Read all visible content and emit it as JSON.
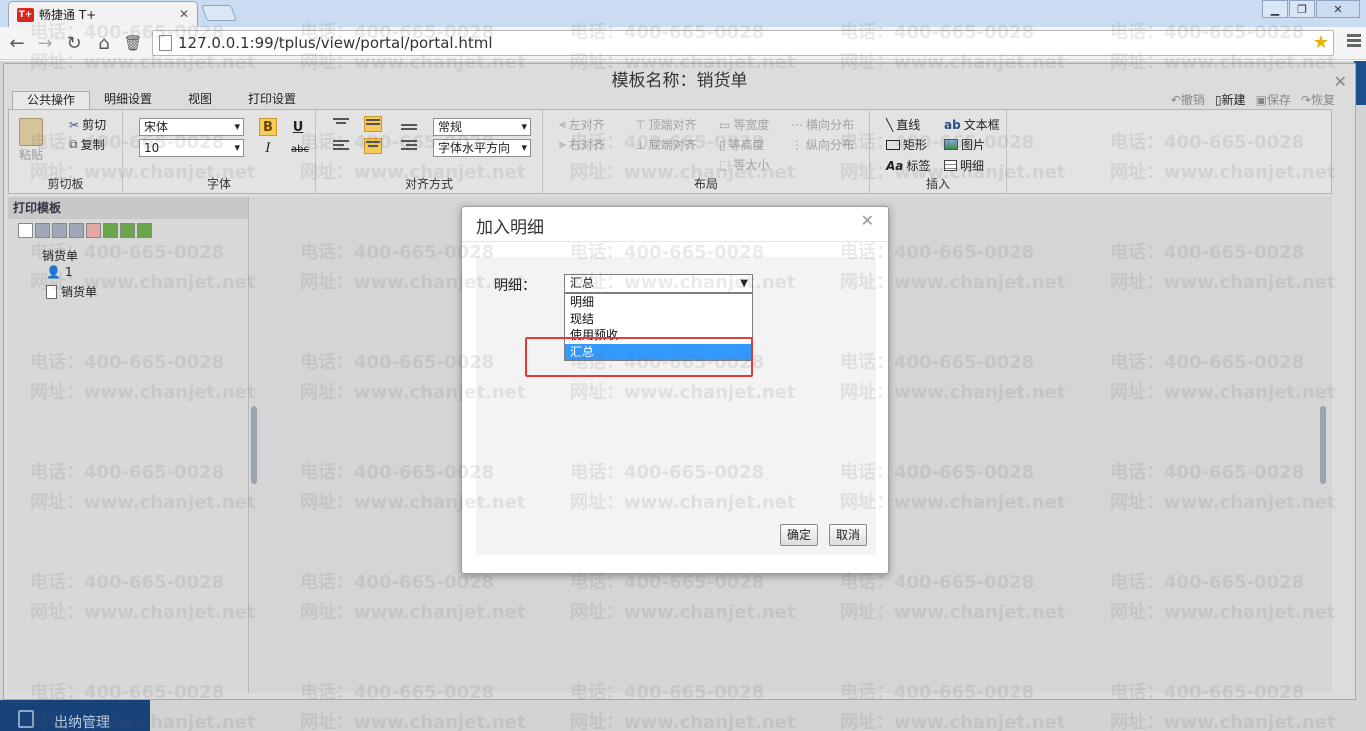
{
  "browser": {
    "tab_title": "畅捷通 T+",
    "tab_favicon": "T+",
    "url": "127.0.0.1:99/tplus/view/portal/portal.html",
    "window_buttons": [
      "▁",
      "❐",
      "✕"
    ]
  },
  "designer": {
    "title": "模板名称：销货单",
    "ribbon_tabs": [
      "公共操作",
      "明细设置",
      "视图",
      "打印设置"
    ],
    "active_tab": "公共操作",
    "quick_actions": [
      {
        "label": "撤销",
        "enabled": false
      },
      {
        "label": "新建",
        "enabled": true
      },
      {
        "label": "保存",
        "enabled": false
      },
      {
        "label": "恢复",
        "enabled": false
      }
    ],
    "clipboard": {
      "label": "剪切板",
      "paste": "粘贴",
      "cut": "剪切",
      "copy": "复制"
    },
    "font": {
      "label": "字体",
      "family": "宋体",
      "size": "10",
      "bold": "B",
      "italic": "I",
      "underline": "U",
      "strike": "abc"
    },
    "alignment": {
      "label": "对齐方式",
      "style_select": "常规",
      "direction_select": "字体水平方向"
    },
    "layout": {
      "label": "布局",
      "items": [
        "左对齐",
        "右对齐",
        "顶端对齐",
        "底端对齐",
        "等宽度",
        "等高度",
        "等大小",
        "横向分布",
        "纵向分布"
      ]
    },
    "insert": {
      "label": "插入",
      "items": [
        "直线",
        "矩形",
        "标签",
        "文本框",
        "图片",
        "明细"
      ]
    }
  },
  "left_panel": {
    "heading": "打印模板",
    "tree": {
      "root": "销货单",
      "children": [
        "1",
        "销货单"
      ]
    }
  },
  "modal": {
    "title": "加入明细",
    "field_label": "明细：",
    "selected_value": "汇总",
    "options": [
      "明细",
      "现结",
      "使用预收",
      "汇总"
    ],
    "highlighted_option": "汇总",
    "confirm": "确定",
    "cancel": "取消"
  },
  "app": {
    "bottom_nav_item": "出纳管理"
  },
  "watermark": {
    "phone": "电话：400-665-0028",
    "site": "网址：www.chanjet.net"
  },
  "colors": {
    "highlight": "#3399ff",
    "annotation_box": "#e53a3a",
    "app_nav": "#17427a"
  }
}
